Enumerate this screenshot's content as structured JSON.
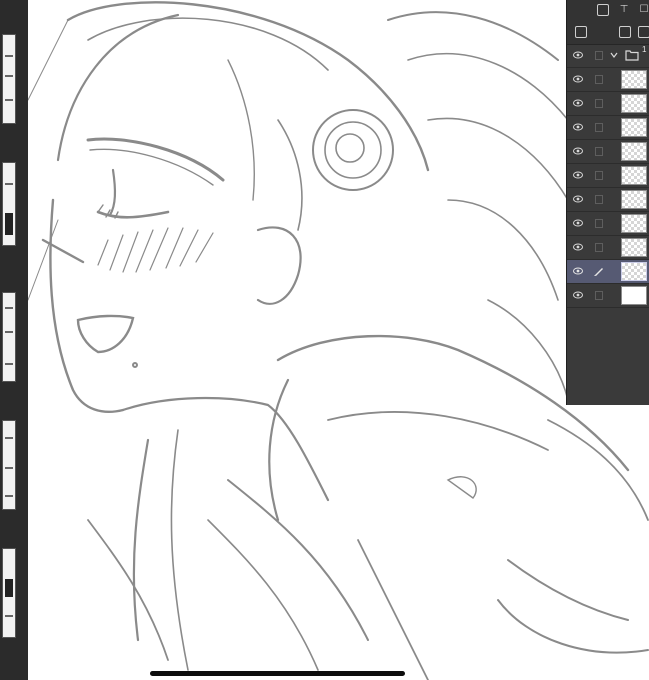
{
  "app": {
    "name": ""
  },
  "layer_panel": {
    "folder_label": "1",
    "layers": [
      {
        "kind": "folder",
        "visible": true
      },
      {
        "kind": "raster",
        "visible": true
      },
      {
        "kind": "raster",
        "visible": true
      },
      {
        "kind": "raster",
        "visible": true
      },
      {
        "kind": "raster",
        "visible": true
      },
      {
        "kind": "raster",
        "visible": true
      },
      {
        "kind": "raster",
        "visible": true
      },
      {
        "kind": "raster",
        "visible": true
      },
      {
        "kind": "raster",
        "visible": true
      },
      {
        "kind": "raster",
        "visible": true,
        "selected": true,
        "editing": true
      },
      {
        "kind": "paper",
        "visible": true
      }
    ]
  },
  "toolbar_icons": [
    "new-layer-icon",
    "transfer-icon",
    "lock-icon",
    "menu-icon",
    "layer-settings-icon",
    "folder-icon",
    "copy-icon"
  ],
  "colors": {
    "panel_bg": "#3a3a3a",
    "selected_row": "#565a73",
    "sketch_line": "#8a8a8a",
    "canvas_bg": "#ffffff",
    "page_strip_bg": "#2b2b2b"
  }
}
